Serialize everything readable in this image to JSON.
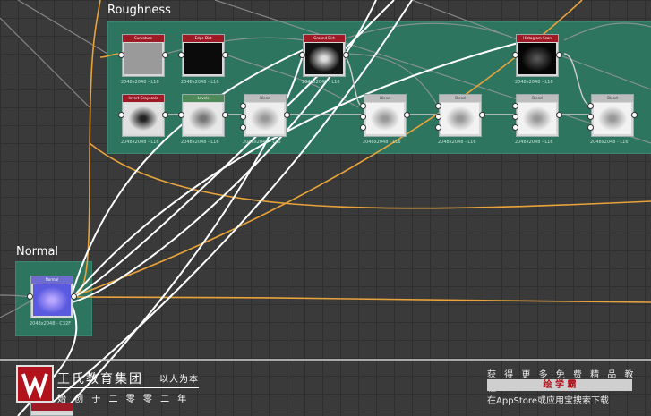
{
  "frames": {
    "roughness_title": "Roughness",
    "normal_title": "Normal"
  },
  "nodes": {
    "curvature": {
      "title": "Curvature",
      "caption": "2048x2048 - L16"
    },
    "edge_dirt": {
      "title": "Edge Dirt",
      "caption": "2048x2048 - L16"
    },
    "ground_dirt": {
      "title": "Ground Dirt",
      "caption": "2048x2048 - L16"
    },
    "histogram_scan": {
      "title": "Histogram Scan",
      "caption": "2048x2048 - L16"
    },
    "invert_grayscale": {
      "title": "Invert Grayscale",
      "caption": "2048x2048 - L16"
    },
    "levels": {
      "title": "Levels",
      "caption": "2048x2048 - L16"
    },
    "blend1": {
      "title": "Blend",
      "caption": "2048x2048 - L16"
    },
    "blend2": {
      "title": "Blend",
      "caption": "2048x2048 - L16"
    },
    "blend3": {
      "title": "Blend",
      "caption": "2048x2048 - L16"
    },
    "blend4": {
      "title": "Blend",
      "caption": "2048x2048 - L16"
    },
    "blend5": {
      "title": "Blend",
      "caption": "2048x2048 - L16"
    },
    "normal": {
      "title": "Normal",
      "caption": "2048x2048 - C32F"
    }
  },
  "watermark": {
    "org_name": "王氏教育集团",
    "slogan": "以人为本",
    "subline": "始 创 于 二 零 零 二 年"
  },
  "promo": {
    "line1": "获 得 更 多 免 费 精 品 教 程",
    "app_name": "绘 学 霸",
    "line3": "在AppStore或应用宝搜索下载"
  },
  "colors": {
    "frame": "#2e7a63",
    "wire_orange": "#e8a33a",
    "wire_white": "#ffffff",
    "header_red": "#9e1a24",
    "header_green": "#4f8a5a"
  }
}
